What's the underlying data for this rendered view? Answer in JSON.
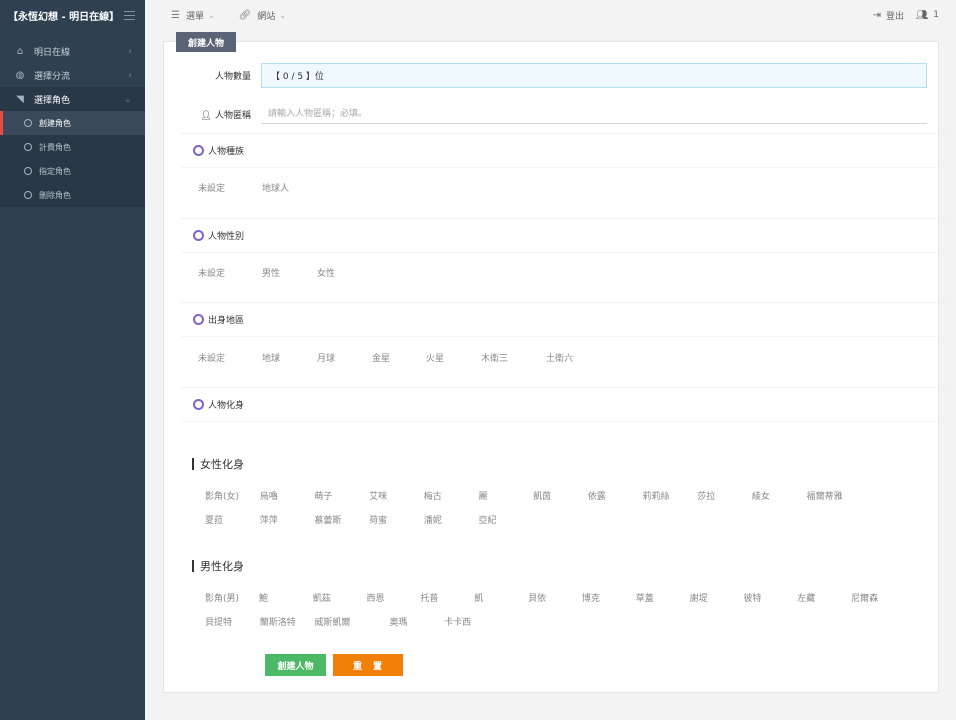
{
  "brand": {
    "title": "【永恆幻想 - 明日在線】"
  },
  "sidebar": {
    "items": [
      {
        "label": "明日在線",
        "icon": "home-icon"
      },
      {
        "label": "選擇分流",
        "icon": "globe-icon"
      },
      {
        "label": "選擇角色",
        "icon": "flag-icon"
      }
    ],
    "subitems": [
      {
        "label": "創建角色"
      },
      {
        "label": "計費角色"
      },
      {
        "label": "指定角色"
      },
      {
        "label": "刪除角色"
      }
    ]
  },
  "topbar": {
    "menu_label": "選單",
    "site_label": "網站",
    "logout_label": "登出",
    "users_count": "1"
  },
  "panel": {
    "tab": "創建人物",
    "count_label": "人物數量",
    "count_value": "【 0 / 5 】位",
    "name_label": "人物匿稱",
    "name_placeholder": "請輸入人物匿稱；必填。",
    "race": {
      "title": "人物種族",
      "options": [
        "未設定",
        "地球人"
      ]
    },
    "gender": {
      "title": "人物性別",
      "options": [
        "未設定",
        "男性",
        "女性"
      ]
    },
    "region": {
      "title": "出身地區",
      "options": [
        "未設定",
        "地球",
        "月球",
        "金星",
        "火星",
        "木衛三",
        "土衛六"
      ]
    },
    "avatar": {
      "title": "人物化身"
    },
    "female": {
      "title": "女性化身",
      "row1": [
        "影角(女)",
        "烏嚕",
        "萌子",
        "艾咪",
        "梅古",
        "麗",
        "凱茵",
        "依露",
        "莉莉絲",
        "莎拉",
        "綾女",
        "福爾蒂雅"
      ],
      "row2": [
        "夏菈",
        "萍萍",
        "慕蕾斯",
        "荷蜜",
        "潘妮",
        "亞紀"
      ]
    },
    "male": {
      "title": "男性化身",
      "row1": [
        "影角(男)",
        "鮑",
        "凱茲",
        "西恩",
        "托普",
        "凱",
        "貝依",
        "博克",
        "草蓋",
        "謝堤",
        "彼特",
        "左藏",
        "尼爾森"
      ],
      "row2": [
        "貝提特",
        "蘭斯洛特",
        "威斯凱爾",
        "奧瑪",
        "卡卡西"
      ]
    },
    "create_button": "創建人物",
    "reset_button": "重　置"
  }
}
